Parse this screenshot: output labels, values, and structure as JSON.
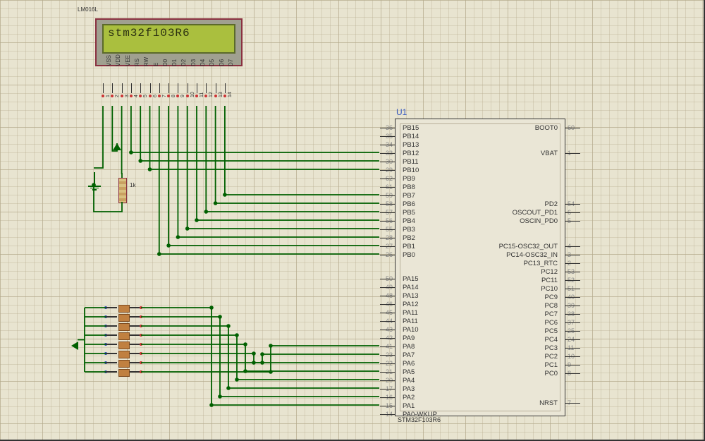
{
  "lcd": {
    "part": "LM016L",
    "text": "stm32f103R6",
    "pins": [
      "VSS",
      "VDD",
      "VEE",
      "RS",
      "RW",
      "E",
      "D0",
      "D1",
      "D2",
      "D3",
      "D4",
      "D5",
      "D6",
      "D7"
    ],
    "pin_numbers": [
      "1",
      "2",
      "3",
      "4",
      "5",
      "6",
      "7",
      "8",
      "9",
      "10",
      "11",
      "12",
      "13",
      "14"
    ]
  },
  "resistor": {
    "value": "1k"
  },
  "mcu": {
    "ref": "U1",
    "part": "STM32F103R6",
    "left_pins": [
      {
        "num": "36",
        "name": "PB15"
      },
      {
        "num": "35",
        "name": "PB14"
      },
      {
        "num": "34",
        "name": "PB13"
      },
      {
        "num": "33",
        "name": "PB12"
      },
      {
        "num": "30",
        "name": "PB11"
      },
      {
        "num": "29",
        "name": "PB10"
      },
      {
        "num": "62",
        "name": "PB9"
      },
      {
        "num": "61",
        "name": "PB8"
      },
      {
        "num": "59",
        "name": "PB7"
      },
      {
        "num": "58",
        "name": "PB6"
      },
      {
        "num": "57",
        "name": "PB5"
      },
      {
        "num": "56",
        "name": "PB4"
      },
      {
        "num": "55",
        "name": "PB3"
      },
      {
        "num": "28",
        "name": "PB2"
      },
      {
        "num": "27",
        "name": "PB1"
      },
      {
        "num": "26",
        "name": "PB0"
      },
      {
        "num": "50",
        "name": "PA15"
      },
      {
        "num": "49",
        "name": "PA14"
      },
      {
        "num": "48",
        "name": "PA13"
      },
      {
        "num": "46",
        "name": "PA12"
      },
      {
        "num": "45",
        "name": "PA11"
      },
      {
        "num": "44",
        "name": "PA11"
      },
      {
        "num": "43",
        "name": "PA10"
      },
      {
        "num": "42",
        "name": "PA9"
      },
      {
        "num": "41",
        "name": "PA8"
      },
      {
        "num": "23",
        "name": "PA7"
      },
      {
        "num": "22",
        "name": "PA6"
      },
      {
        "num": "21",
        "name": "PA5"
      },
      {
        "num": "20",
        "name": "PA4"
      },
      {
        "num": "17",
        "name": "PA3"
      },
      {
        "num": "16",
        "name": "PA2"
      },
      {
        "num": "15",
        "name": "PA1"
      },
      {
        "num": "14",
        "name": "PA0-WKUP"
      }
    ],
    "right_pins": [
      {
        "num": "60",
        "name": "BOOT0"
      },
      {
        "num": "1",
        "name": "VBAT"
      },
      {
        "num": "54",
        "name": "PD2"
      },
      {
        "num": "6",
        "name": "OSCOUT_PD1"
      },
      {
        "num": "5",
        "name": "OSCIN_PD0"
      },
      {
        "num": "4",
        "name": "PC15-OSC32_OUT"
      },
      {
        "num": "3",
        "name": "PC14-OSC32_IN"
      },
      {
        "num": "2",
        "name": "PC13_RTC"
      },
      {
        "num": "53",
        "name": "PC12"
      },
      {
        "num": "52",
        "name": "PC11"
      },
      {
        "num": "51",
        "name": "PC10"
      },
      {
        "num": "40",
        "name": "PC9"
      },
      {
        "num": "39",
        "name": "PC8"
      },
      {
        "num": "38",
        "name": "PC7"
      },
      {
        "num": "37",
        "name": "PC6"
      },
      {
        "num": "25",
        "name": "PC5"
      },
      {
        "num": "24",
        "name": "PC4"
      },
      {
        "num": "11",
        "name": "PC3"
      },
      {
        "num": "10",
        "name": "PC2"
      },
      {
        "num": "9",
        "name": "PC1"
      },
      {
        "num": "8",
        "name": "PC0"
      },
      {
        "num": "7",
        "name": "NRST"
      }
    ]
  },
  "connections": {
    "lcd_ctrl": [
      {
        "from": "LCD.RS",
        "to": "PB12"
      },
      {
        "from": "LCD.RW",
        "to": "PB11"
      },
      {
        "from": "LCD.E",
        "to": "PB10"
      }
    ],
    "lcd_data": [
      {
        "from": "LCD.D0",
        "to": "PB0"
      },
      {
        "from": "LCD.D1",
        "to": "PB1"
      },
      {
        "from": "LCD.D2",
        "to": "PB2"
      },
      {
        "from": "LCD.D3",
        "to": "PB3"
      },
      {
        "from": "LCD.D4",
        "to": "PB4"
      },
      {
        "from": "LCD.D5",
        "to": "PB5"
      },
      {
        "from": "LCD.D6",
        "to": "PB6"
      },
      {
        "from": "LCD.D7",
        "to": "PB7"
      }
    ],
    "buttons_to": [
      "PA1",
      "PA2",
      "PA3",
      "PA4",
      "PA5",
      "PA6",
      "PA7",
      "PA8"
    ],
    "lcd_power": {
      "VSS": "GND",
      "VDD": "VCC",
      "VEE": "1k→GND",
      "RW_pullup": "via PB11"
    }
  }
}
